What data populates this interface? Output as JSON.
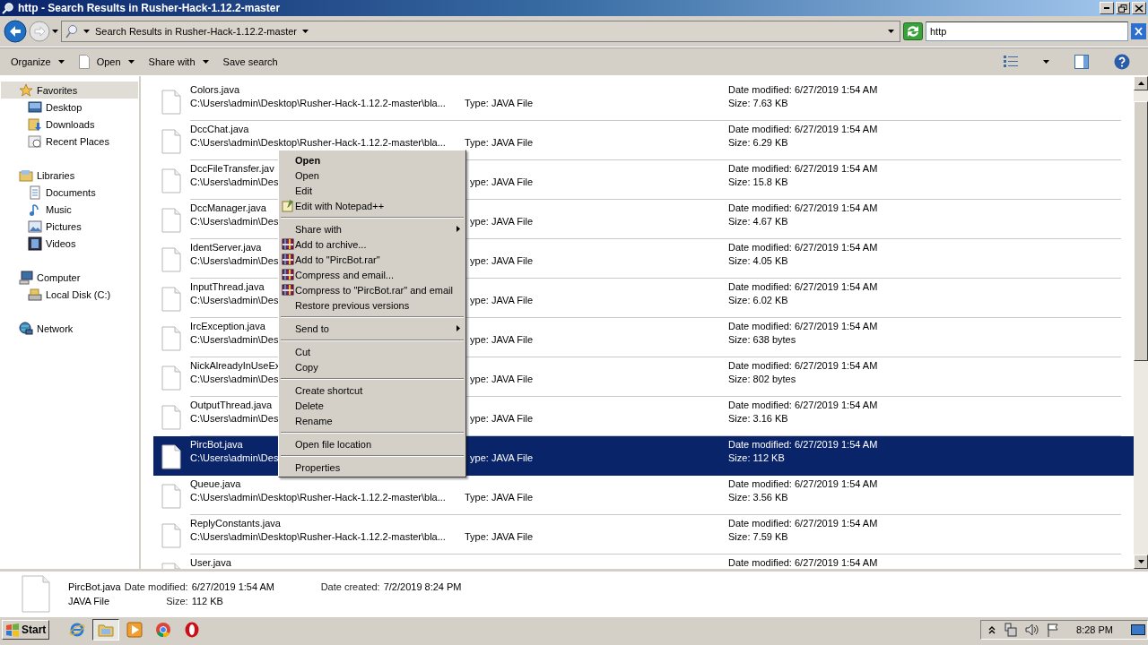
{
  "window": {
    "title": "http - Search Results in Rusher-Hack-1.12.2-master"
  },
  "address_bar": {
    "breadcrumb": "Search Results in Rusher-Hack-1.12.2-master",
    "search": {
      "value": "http"
    }
  },
  "toolbar": {
    "buttons": [
      {
        "label": "Organize",
        "kind": "plain",
        "dropdown": true
      },
      {
        "label": "Open",
        "kind": "document",
        "dropdown": true
      },
      {
        "label": "Share with",
        "kind": "plain",
        "dropdown": true
      },
      {
        "label": "Save search",
        "kind": "plain",
        "dropdown": false
      }
    ]
  },
  "sidebar": {
    "groups": [
      {
        "label": "Favorites",
        "kind": "star",
        "selected": true,
        "children": [
          {
            "label": "Desktop",
            "kind": "desktop",
            "selected": false
          },
          {
            "label": "Downloads",
            "kind": "downloads",
            "selected": false
          },
          {
            "label": "Recent Places",
            "kind": "recent",
            "selected": false
          }
        ]
      },
      {
        "label": "Libraries",
        "kind": "libraries",
        "selected": false,
        "children": [
          {
            "label": "Documents",
            "kind": "documents",
            "selected": false
          },
          {
            "label": "Music",
            "kind": "music",
            "selected": false
          },
          {
            "label": "Pictures",
            "kind": "pictures",
            "selected": false
          },
          {
            "label": "Videos",
            "kind": "videos",
            "selected": false
          }
        ]
      },
      {
        "label": "Computer",
        "kind": "computer",
        "selected": false,
        "children": [
          {
            "label": "Local Disk (C:)",
            "kind": "disk",
            "selected": false
          }
        ]
      },
      {
        "label": "Network",
        "kind": "network",
        "selected": false
      }
    ]
  },
  "files": [
    {
      "name": "Colors.java",
      "path": "C:\\Users\\admin\\Desktop\\Rusher-Hack-1.12.2-master\\bla...",
      "type": "Type: JAVA File",
      "modified": "Date modified: 6/27/2019 1:54 AM",
      "size": "Size: 7.63 KB",
      "selected": false
    },
    {
      "name": "DccChat.java",
      "path": "C:\\Users\\admin\\Desktop\\Rusher-Hack-1.12.2-master\\bla...",
      "type": "Type: JAVA File",
      "modified": "Date modified: 6/27/2019 1:54 AM",
      "size": "Size: 6.29 KB",
      "selected": false
    },
    {
      "name": "DccFileTransfer.jav",
      "path": "C:\\Users\\admin\\Des",
      "type": "ype: JAVA File",
      "modified": "Date modified: 6/27/2019 1:54 AM",
      "size": "Size: 15.8 KB",
      "selected": false
    },
    {
      "name": "DccManager.java",
      "path": "C:\\Users\\admin\\Des",
      "type": "ype: JAVA File",
      "modified": "Date modified: 6/27/2019 1:54 AM",
      "size": "Size: 4.67 KB",
      "selected": false
    },
    {
      "name": "IdentServer.java",
      "path": "C:\\Users\\admin\\Des",
      "type": "ype: JAVA File",
      "modified": "Date modified: 6/27/2019 1:54 AM",
      "size": "Size: 4.05 KB",
      "selected": false
    },
    {
      "name": "InputThread.java",
      "path": "C:\\Users\\admin\\Des",
      "type": "ype: JAVA File",
      "modified": "Date modified: 6/27/2019 1:54 AM",
      "size": "Size: 6.02 KB",
      "selected": false
    },
    {
      "name": "IrcException.java",
      "path": "C:\\Users\\admin\\Des",
      "type": "ype: JAVA File",
      "modified": "Date modified: 6/27/2019 1:54 AM",
      "size": "Size: 638 bytes",
      "selected": false
    },
    {
      "name": "NickAlreadyInUseEx",
      "path": "C:\\Users\\admin\\Des",
      "type": "ype: JAVA File",
      "modified": "Date modified: 6/27/2019 1:54 AM",
      "size": "Size: 802 bytes",
      "selected": false
    },
    {
      "name": "OutputThread.java",
      "path": "C:\\Users\\admin\\Des",
      "type": "ype: JAVA File",
      "modified": "Date modified: 6/27/2019 1:54 AM",
      "size": "Size: 3.16 KB",
      "selected": false
    },
    {
      "name": "PircBot.java",
      "path": "C:\\Users\\admin\\Des",
      "type": "ype: JAVA File",
      "modified": "Date modified: 6/27/2019 1:54 AM",
      "size": "Size: 112 KB",
      "selected": true
    },
    {
      "name": "Queue.java",
      "path": "C:\\Users\\admin\\Desktop\\Rusher-Hack-1.12.2-master\\bla...",
      "type": "Type: JAVA File",
      "modified": "Date modified: 6/27/2019 1:54 AM",
      "size": "Size: 3.56 KB",
      "selected": false
    },
    {
      "name": "ReplyConstants.java",
      "path": "C:\\Users\\admin\\Desktop\\Rusher-Hack-1.12.2-master\\bla...",
      "type": "Type: JAVA File",
      "modified": "Date modified: 6/27/2019 1:54 AM",
      "size": "Size: 7.59 KB",
      "selected": false
    },
    {
      "name": "User.java",
      "modified": "Date modified: 6/27/2019 1:54 AM",
      "selected": false
    }
  ],
  "context_menu": {
    "items": [
      {
        "label": "Open",
        "kind": "default"
      },
      {
        "label": "Open",
        "kind": "plain"
      },
      {
        "label": "Edit",
        "kind": "plain"
      },
      {
        "label": "Edit with Notepad++",
        "kind": "notepad"
      },
      {
        "kind": "separator"
      },
      {
        "label": "Share with",
        "kind": "submenu"
      },
      {
        "label": "Add to archive...",
        "kind": "archive"
      },
      {
        "label": "Add to \"PircBot.rar\"",
        "kind": "archive"
      },
      {
        "label": "Compress and email...",
        "kind": "archive"
      },
      {
        "label": "Compress to \"PircBot.rar\" and email",
        "kind": "archive"
      },
      {
        "label": "Restore previous versions",
        "kind": "plain"
      },
      {
        "kind": "separator"
      },
      {
        "label": "Send to",
        "kind": "submenu"
      },
      {
        "kind": "separator"
      },
      {
        "label": "Cut",
        "kind": "plain"
      },
      {
        "label": "Copy",
        "kind": "plain"
      },
      {
        "kind": "separator"
      },
      {
        "label": "Create shortcut",
        "kind": "plain"
      },
      {
        "label": "Delete",
        "kind": "plain"
      },
      {
        "label": "Rename",
        "kind": "plain"
      },
      {
        "kind": "separator"
      },
      {
        "label": "Open file location",
        "kind": "plain"
      },
      {
        "kind": "separator"
      },
      {
        "label": "Properties",
        "kind": "plain"
      }
    ]
  },
  "details": {
    "lines": [
      {
        "title": "PircBot.java",
        "fields": [
          {
            "label": "Date modified:",
            "value": "6/27/2019 1:54 AM"
          },
          {
            "label": "Date created:",
            "value": "7/2/2019 8:24 PM"
          }
        ]
      },
      {
        "title": "JAVA File",
        "fields": [
          {
            "label": "Size:",
            "value": "112 KB"
          }
        ]
      }
    ]
  },
  "taskbar": {
    "start": "Start",
    "apps": [
      {
        "kind": "ie",
        "active": false
      },
      {
        "kind": "explorer",
        "active": true
      },
      {
        "kind": "media",
        "active": false
      },
      {
        "kind": "chrome",
        "active": false
      },
      {
        "kind": "opera",
        "active": false
      }
    ],
    "clock": "8:28 PM"
  }
}
